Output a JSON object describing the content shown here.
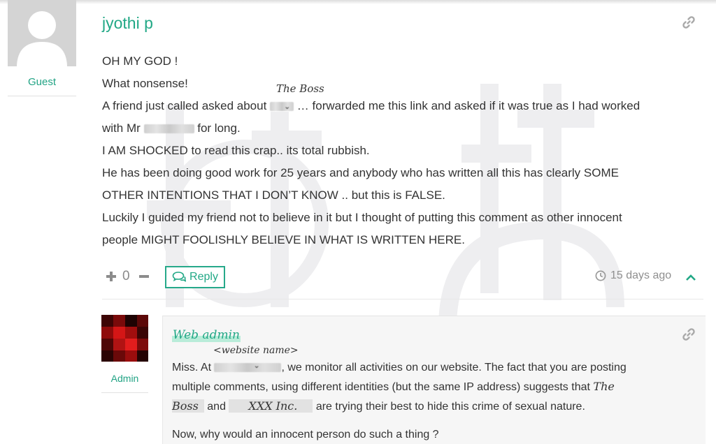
{
  "main_comment": {
    "author": "jyothi p",
    "role": "Guest",
    "lines": [
      "OH MY GOD !",
      "What nonsense!",
      "I AM SHOCKED to read this crap.. its total rubbish.",
      "He has been doing good work for 25 years and anybody who has written all this has clearly SOME",
      "OTHER INTENTIONS THAT I DON’T KNOW .. but this is FALSE.",
      "Luckily I guided my friend not to believe in it but I thought of putting this comment as other innocent",
      "people MIGHT FOOLISHLY BELIEVE IN WHAT IS WRITTEN HERE."
    ],
    "line3_pre": "A friend just called asked about",
    "line3_post": "… forwarded me this link and asked if it was true as I had worked",
    "line4_pre": "with Mr",
    "line4_post": "for long.",
    "annotation_boss": "The Boss",
    "vote_count": "0",
    "reply_label": "Reply",
    "timestamp": "15 days ago"
  },
  "reply_comment": {
    "author": "Web admin",
    "role": "Admin",
    "annotation_site": "<website name>",
    "p1_pre": "Miss. At",
    "p1_mid1": ", we monitor all activities on our website. The fact that you are posting",
    "p1_line2": "multiple comments, using different identities (but the same IP address) suggests that",
    "handwritten_the": "The",
    "handwritten_boss": "Boss",
    "p1_and": "and",
    "handwritten_xxx": "XXX Inc.",
    "p1_end": "are trying their best to hide this crime of sexual nature.",
    "p2": "Now, why would an innocent person do such a thing ?"
  },
  "icons": [
    "link-icon",
    "plus-icon",
    "minus-icon",
    "chat-icon",
    "clock-icon",
    "chevron-up-icon"
  ],
  "colors": {
    "accent": "#22a886",
    "muted": "#8f8f8f",
    "reply_bg": "#f6f6f6"
  }
}
